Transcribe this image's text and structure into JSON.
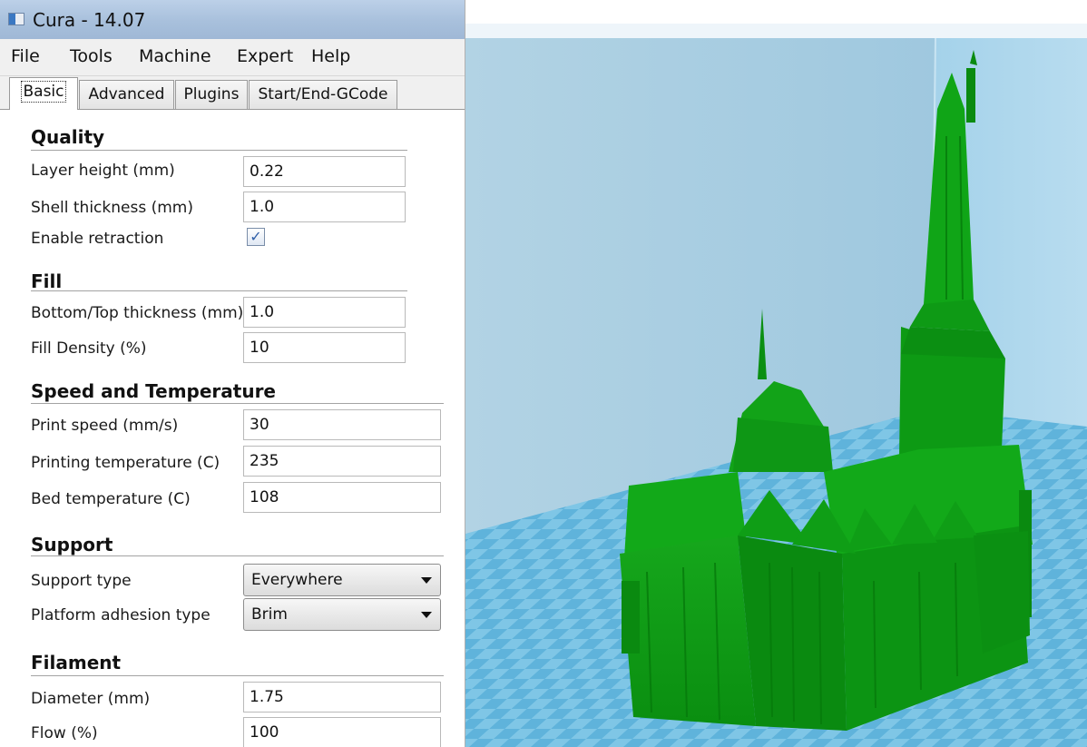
{
  "window": {
    "title": "Cura - 14.07"
  },
  "menu": {
    "file": "File",
    "tools": "Tools",
    "machine": "Machine",
    "expert": "Expert",
    "help": "Help"
  },
  "tabs": {
    "basic": "Basic",
    "advanced": "Advanced",
    "plugins": "Plugins",
    "startend": "Start/End-GCode"
  },
  "quality": {
    "title": "Quality",
    "layer_height_label": "Layer height (mm)",
    "layer_height_value": "0.22",
    "shell_thickness_label": "Shell thickness (mm)",
    "shell_thickness_value": "1.0",
    "enable_retraction_label": "Enable retraction",
    "enable_retraction_checked": true
  },
  "fill": {
    "title": "Fill",
    "bottom_top_label": "Bottom/Top thickness (mm)",
    "bottom_top_value": "1.0",
    "fill_density_label": "Fill Density (%)",
    "fill_density_value": "10"
  },
  "speed": {
    "title": "Speed and Temperature",
    "print_speed_label": "Print speed (mm/s)",
    "print_speed_value": "30",
    "printing_temp_label": "Printing temperature (C)",
    "printing_temp_value": "235",
    "bed_temp_label": "Bed temperature (C)",
    "bed_temp_value": "108"
  },
  "support": {
    "title": "Support",
    "support_type_label": "Support type",
    "support_type_value": "Everywhere",
    "adhesion_label": "Platform adhesion type",
    "adhesion_value": "Brim"
  },
  "filament": {
    "title": "Filament",
    "diameter_label": "Diameter (mm)",
    "diameter_value": "1.75",
    "flow_label": "Flow (%)",
    "flow_value": "100"
  },
  "colors": {
    "build_volume": "#a9cfe3",
    "build_plate": "#8ecdea",
    "model": "#0a9a12"
  },
  "icons": {
    "app": "cura-app-icon",
    "check": "checkmark-icon",
    "dropdown": "chevron-down-icon"
  }
}
